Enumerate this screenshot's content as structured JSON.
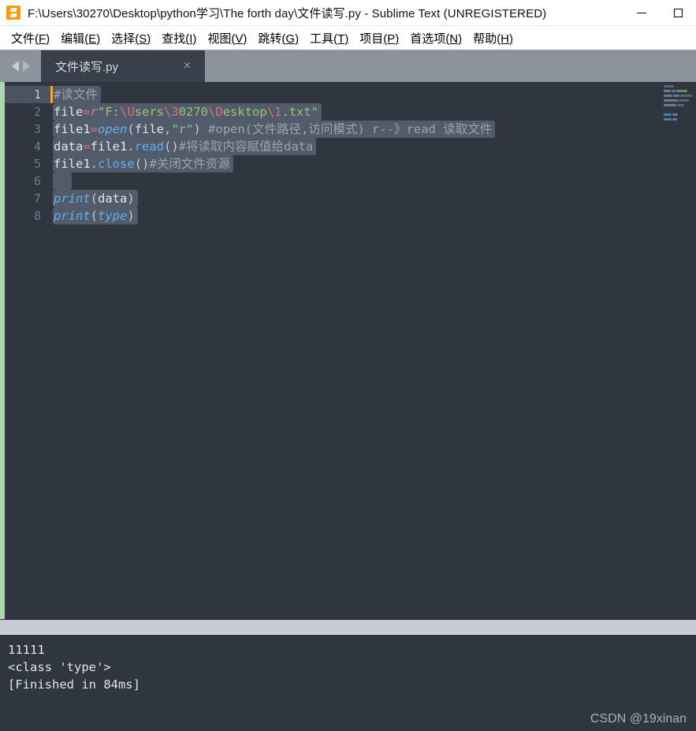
{
  "window": {
    "title": "F:\\Users\\30270\\Desktop\\python学习\\The forth day\\文件读写.py - Sublime Text (UNREGISTERED)",
    "app_icon": "sublime-text-logo-icon",
    "minimize_label": "—",
    "maximize_label": "□"
  },
  "menubar": {
    "items": [
      {
        "label": "文件",
        "accel": "(F)"
      },
      {
        "label": "编辑",
        "accel": "(E)"
      },
      {
        "label": "选择",
        "accel": "(S)"
      },
      {
        "label": "查找",
        "accel": "(I)"
      },
      {
        "label": "视图",
        "accel": "(V)"
      },
      {
        "label": "跳转",
        "accel": "(G)"
      },
      {
        "label": "工具",
        "accel": "(T)"
      },
      {
        "label": "项目",
        "accel": "(P)"
      },
      {
        "label": "首选项",
        "accel": "(N)"
      },
      {
        "label": "帮助",
        "accel": "(H)"
      }
    ]
  },
  "tabbar": {
    "prev_icon": "arrow-left-icon",
    "next_icon": "arrow-right-icon",
    "tabs": [
      {
        "label": "文件读写.py",
        "close_label": "×",
        "active": true
      }
    ]
  },
  "editor": {
    "active_line": 1,
    "line_numbers": [
      "1",
      "2",
      "3",
      "4",
      "5",
      "6",
      "7",
      "8"
    ],
    "lines": [
      {
        "n": "1",
        "tokens": [
          {
            "t": "#读文件",
            "c": "t-comment"
          }
        ]
      },
      {
        "n": "2",
        "tokens": [
          {
            "t": "file",
            "c": "t-plain"
          },
          {
            "t": "=",
            "c": "t-op"
          },
          {
            "t": "r",
            "c": "t-keyword"
          },
          {
            "t": "\"F:",
            "c": "t-string"
          },
          {
            "t": "\\U",
            "c": "t-esc"
          },
          {
            "t": "sers",
            "c": "t-string"
          },
          {
            "t": "\\3",
            "c": "t-esc"
          },
          {
            "t": "0270",
            "c": "t-string"
          },
          {
            "t": "\\D",
            "c": "t-esc"
          },
          {
            "t": "esktop",
            "c": "t-string"
          },
          {
            "t": "\\1",
            "c": "t-esc"
          },
          {
            "t": ".txt\"",
            "c": "t-string"
          }
        ]
      },
      {
        "n": "3",
        "tokens": [
          {
            "t": "file1",
            "c": "t-plain"
          },
          {
            "t": "=",
            "c": "t-op"
          },
          {
            "t": "open",
            "c": "t-fn"
          },
          {
            "t": "(",
            "c": "t-punct"
          },
          {
            "t": "file",
            "c": "t-plain"
          },
          {
            "t": ",",
            "c": "t-punct"
          },
          {
            "t": "\"r\"",
            "c": "t-string"
          },
          {
            "t": ")",
            "c": "t-punct"
          },
          {
            "t": " ",
            "c": "t-dot"
          },
          {
            "t": "#open(文件路径,访问模式) r--》read 读取文件",
            "c": "t-comment"
          }
        ]
      },
      {
        "n": "4",
        "tokens": [
          {
            "t": "data",
            "c": "t-plain"
          },
          {
            "t": "=",
            "c": "t-op"
          },
          {
            "t": "file1",
            "c": "t-plain"
          },
          {
            "t": ".",
            "c": "t-punct"
          },
          {
            "t": "read",
            "c": "t-method"
          },
          {
            "t": "()",
            "c": "t-punct"
          },
          {
            "t": "#将读取内容赋值给data",
            "c": "t-comment"
          }
        ]
      },
      {
        "n": "5",
        "tokens": [
          {
            "t": "file1",
            "c": "t-plain"
          },
          {
            "t": ".",
            "c": "t-punct"
          },
          {
            "t": "close",
            "c": "t-method"
          },
          {
            "t": "()",
            "c": "t-punct"
          },
          {
            "t": "#关闭文件资源",
            "c": "t-comment"
          }
        ]
      },
      {
        "n": "6",
        "tokens": [
          {
            "t": "  ",
            "c": "t-plain"
          }
        ]
      },
      {
        "n": "7",
        "tokens": [
          {
            "t": "print",
            "c": "t-fn"
          },
          {
            "t": "(",
            "c": "t-punct"
          },
          {
            "t": "data",
            "c": "t-plain"
          },
          {
            "t": ")",
            "c": "t-punct"
          }
        ]
      },
      {
        "n": "8",
        "tokens": [
          {
            "t": "print",
            "c": "t-fn"
          },
          {
            "t": "(",
            "c": "t-punct"
          },
          {
            "t": "type",
            "c": "t-fn"
          },
          {
            "t": ")",
            "c": "t-punct"
          }
        ]
      }
    ],
    "minimap": [
      {
        "segs": [
          {
            "w": 13,
            "color": "#5a6676"
          }
        ]
      },
      {
        "segs": [
          {
            "w": 9,
            "color": "#6b7a8c"
          },
          {
            "w": 5,
            "color": "#7d6a8c"
          },
          {
            "w": 14,
            "color": "#6f8a63"
          }
        ]
      },
      {
        "segs": [
          {
            "w": 11,
            "color": "#6b7a8c"
          },
          {
            "w": 8,
            "color": "#4d7fa8"
          },
          {
            "w": 15,
            "color": "#5a6676"
          }
        ]
      },
      {
        "segs": [
          {
            "w": 18,
            "color": "#6b7a8c"
          },
          {
            "w": 13,
            "color": "#5a6676"
          }
        ]
      },
      {
        "segs": [
          {
            "w": 16,
            "color": "#6b7a8c"
          },
          {
            "w": 9,
            "color": "#5a6676"
          }
        ]
      },
      {
        "segs": []
      },
      {
        "segs": [
          {
            "w": 10,
            "color": "#4d7fa8"
          },
          {
            "w": 7,
            "color": "#6b7a8c"
          }
        ]
      },
      {
        "segs": [
          {
            "w": 10,
            "color": "#4d7fa8"
          },
          {
            "w": 6,
            "color": "#4d7fa8"
          }
        ]
      }
    ]
  },
  "console": {
    "lines": [
      "11111",
      "<class 'type'>",
      "[Finished in 84ms]"
    ]
  },
  "watermark": {
    "text": "CSDN @19xinan"
  }
}
